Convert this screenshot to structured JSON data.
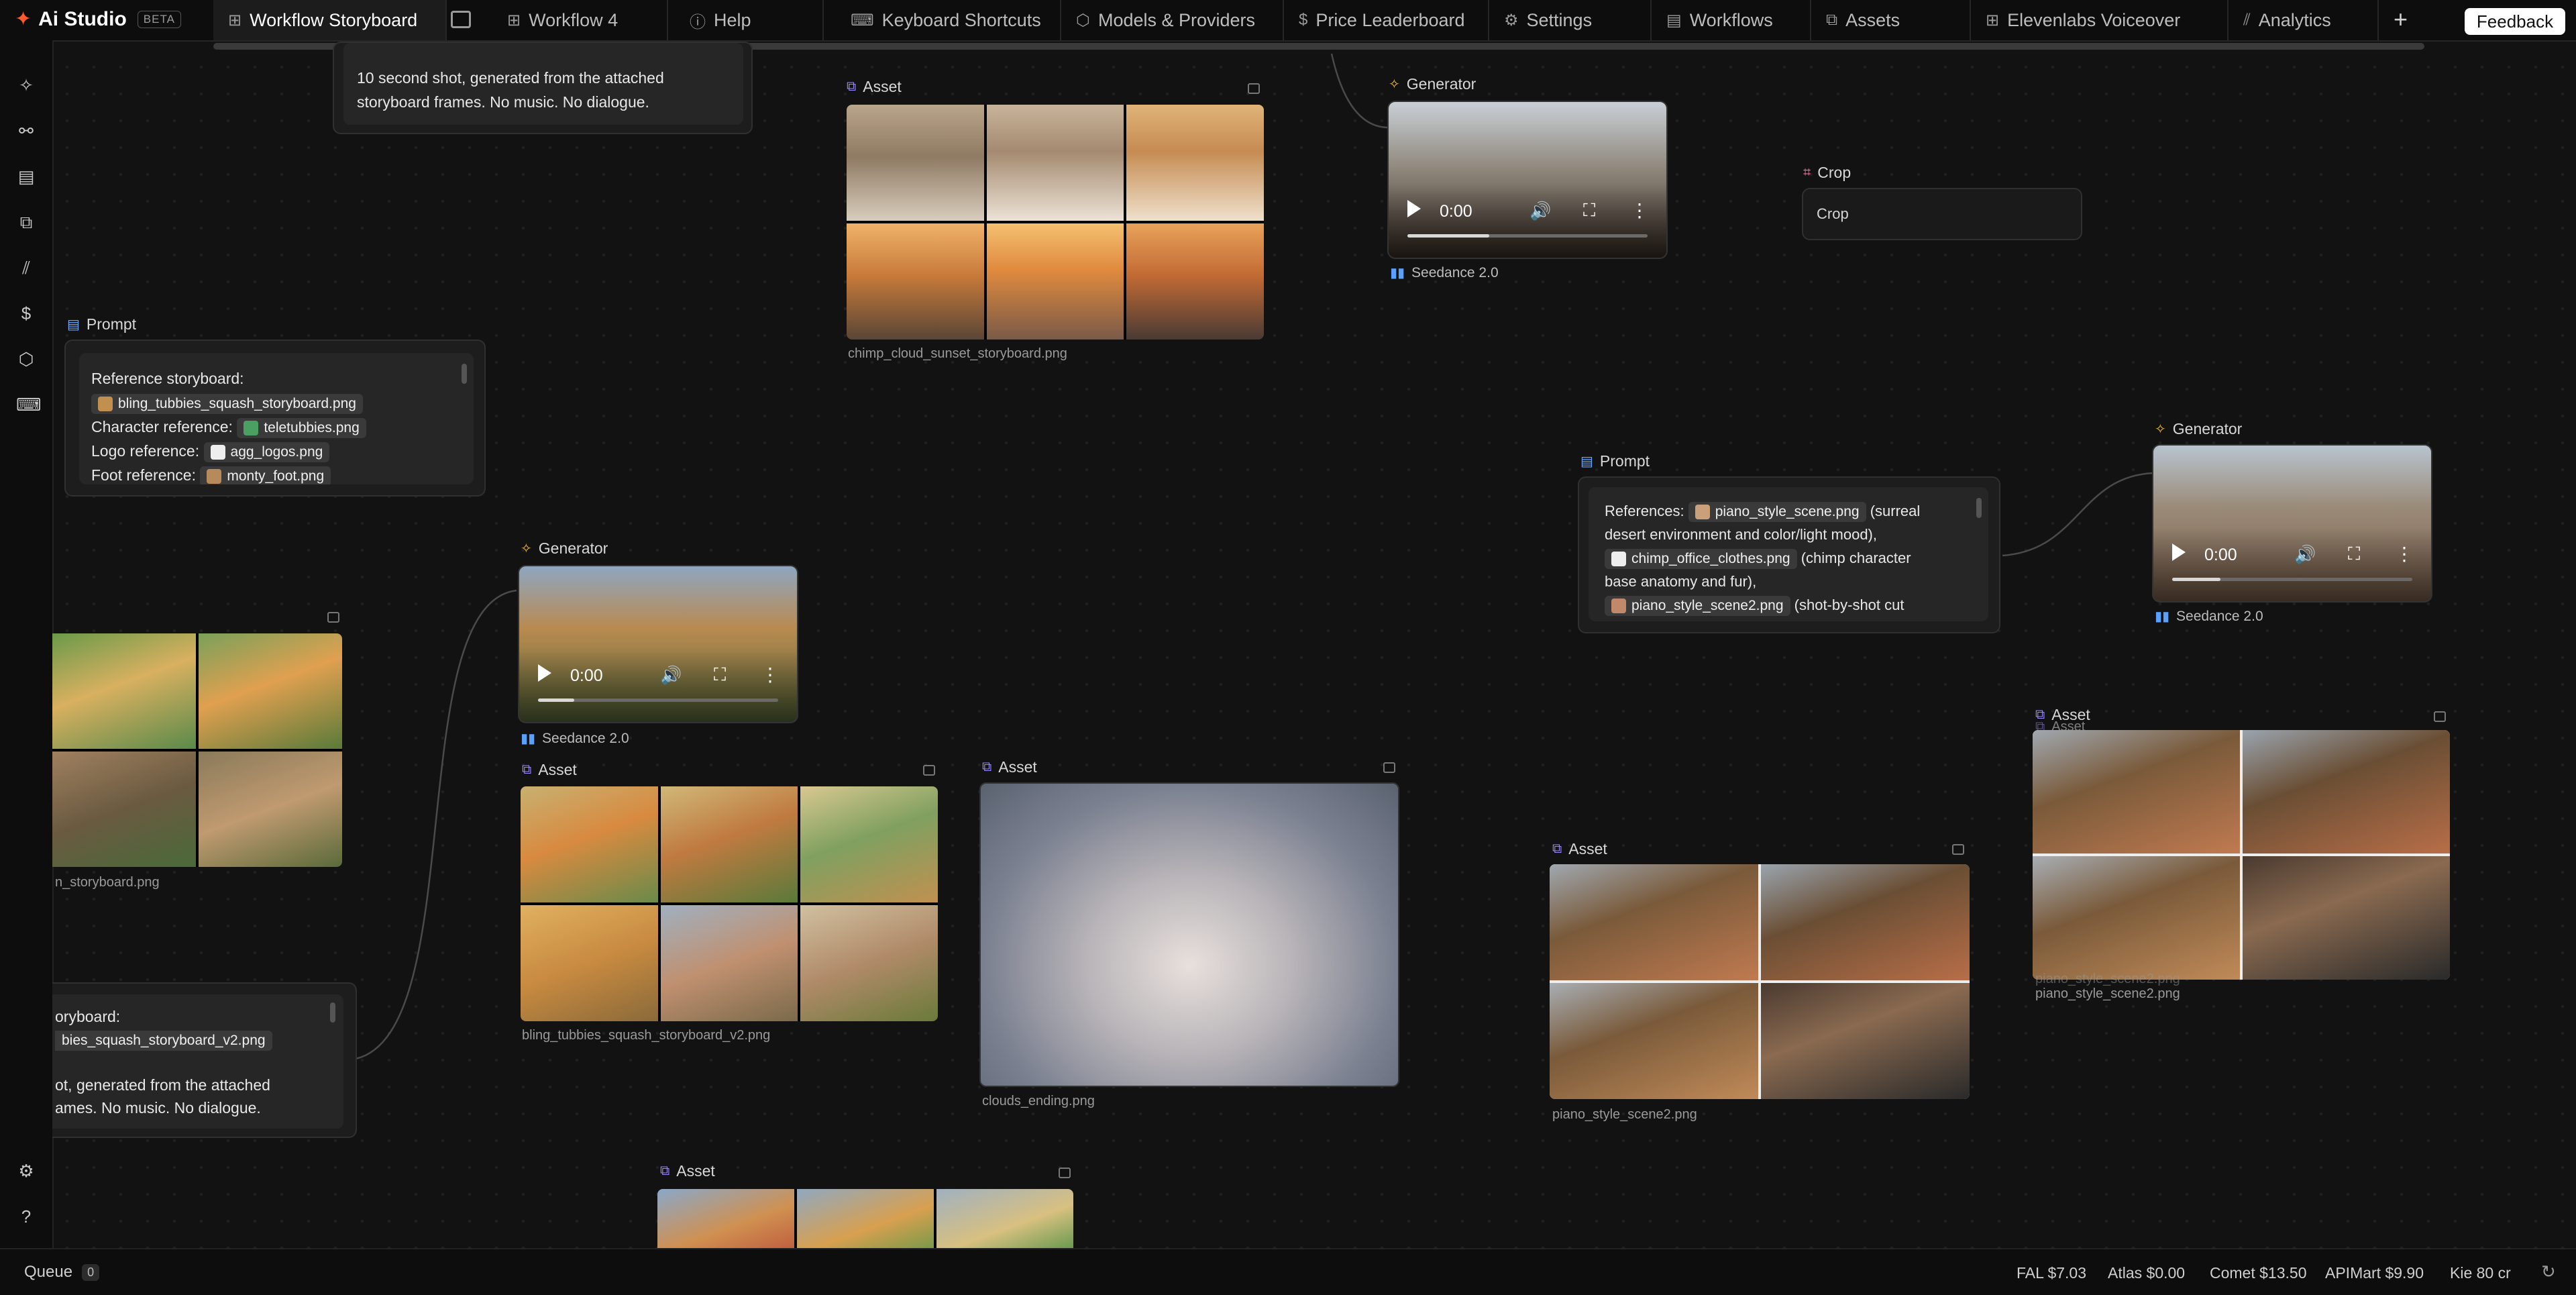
{
  "app": {
    "name": "Ai Studio",
    "badge": "BETA"
  },
  "tabs": [
    {
      "label": "Workflow Storyboard",
      "icon": "grid-icon",
      "active": true
    },
    {
      "label": "Workflow 4",
      "icon": "grid-icon"
    },
    {
      "label": "Help",
      "icon": "help-icon"
    },
    {
      "label": "Keyboard Shortcuts",
      "icon": "keyboard-icon"
    },
    {
      "label": "Models & Providers",
      "icon": "cube-icon"
    },
    {
      "label": "Price Leaderboard",
      "icon": "dollar-icon"
    },
    {
      "label": "Settings",
      "icon": "gear-icon"
    },
    {
      "label": "Workflows",
      "icon": "layers-icon"
    },
    {
      "label": "Assets",
      "icon": "assets-icon"
    },
    {
      "label": "Elevenlabs Voiceover",
      "icon": "grid-icon"
    },
    {
      "label": "Analytics",
      "icon": "chart-icon"
    }
  ],
  "feedback_label": "Feedback",
  "nodes": {
    "prompt_top": {
      "text1": "10 second shot, generated from the attached",
      "text2": "storyboard frames. No music. No dialogue."
    },
    "asset_chimp": {
      "title": "Asset",
      "filename": "chimp_cloud_sunset_storyboard.png"
    },
    "gen_top": {
      "title": "Generator",
      "time": "0:00",
      "model": "Seedance 2.0"
    },
    "crop": {
      "title": "Crop",
      "label": "Crop"
    },
    "prompt_left": {
      "title": "Prompt",
      "line1_label": "Reference storyboard:",
      "line1_chip": "bling_tubbies_squash_storyboard.png",
      "line2_label": "Character reference:",
      "line2_chip": "teletubbies.png",
      "line3_label": "Logo reference:",
      "line3_chip": "agg_logos.png",
      "line4_label": "Foot reference:",
      "line4_chip": "monty_foot.png"
    },
    "prompt_right": {
      "title": "Prompt",
      "label": "References:",
      "chip1": "piano_style_scene.png",
      "text1": "(surreal",
      "text2": "desert environment and color/light mood),",
      "chip2": "chimp_office_clothes.png",
      "text3": "(chimp character",
      "text4": "base anatomy and fur),",
      "chip3": "piano_style_scene2.png",
      "text5": "(shot-by-shot cut"
    },
    "gen_right": {
      "title": "Generator",
      "time": "0:00",
      "model": "Seedance 2.0"
    },
    "asset_left_partial": {
      "filename": "n_storyboard.png"
    },
    "gen_mid": {
      "title": "Generator",
      "time": "0:00",
      "model": "Seedance 2.0"
    },
    "asset_bling": {
      "title": "Asset",
      "filename": "bling_tubbies_squash_storyboard_v2.png"
    },
    "asset_clouds": {
      "title": "Asset",
      "filename": "clouds_ending.png"
    },
    "asset_piano": {
      "title": "Asset",
      "filename": "piano_style_scene2.png"
    },
    "asset_piano2": {
      "title": "Asset",
      "title_ghost": "Asset",
      "filename": "piano_style_scene2.png",
      "filename_ghost": "piano_style_scene2.png"
    },
    "prompt_bottom_partial": {
      "line1": "oryboard:",
      "chip": "bies_squash_storyboard_v2.png",
      "line3": "ot, generated from the attached",
      "line4": "ames. No music. No dialogue."
    },
    "asset_bottom": {
      "title": "Asset"
    }
  },
  "bottom": {
    "queue_label": "Queue",
    "queue_count": "0",
    "costs": [
      "FAL $7.03",
      "Atlas $0.00",
      "Comet $13.50",
      "APIMart $9.90",
      "Kie 80 cr"
    ]
  },
  "colors": {
    "accent": "#ff5a2b",
    "background": "#121212",
    "panel": "#1d1d1d"
  }
}
